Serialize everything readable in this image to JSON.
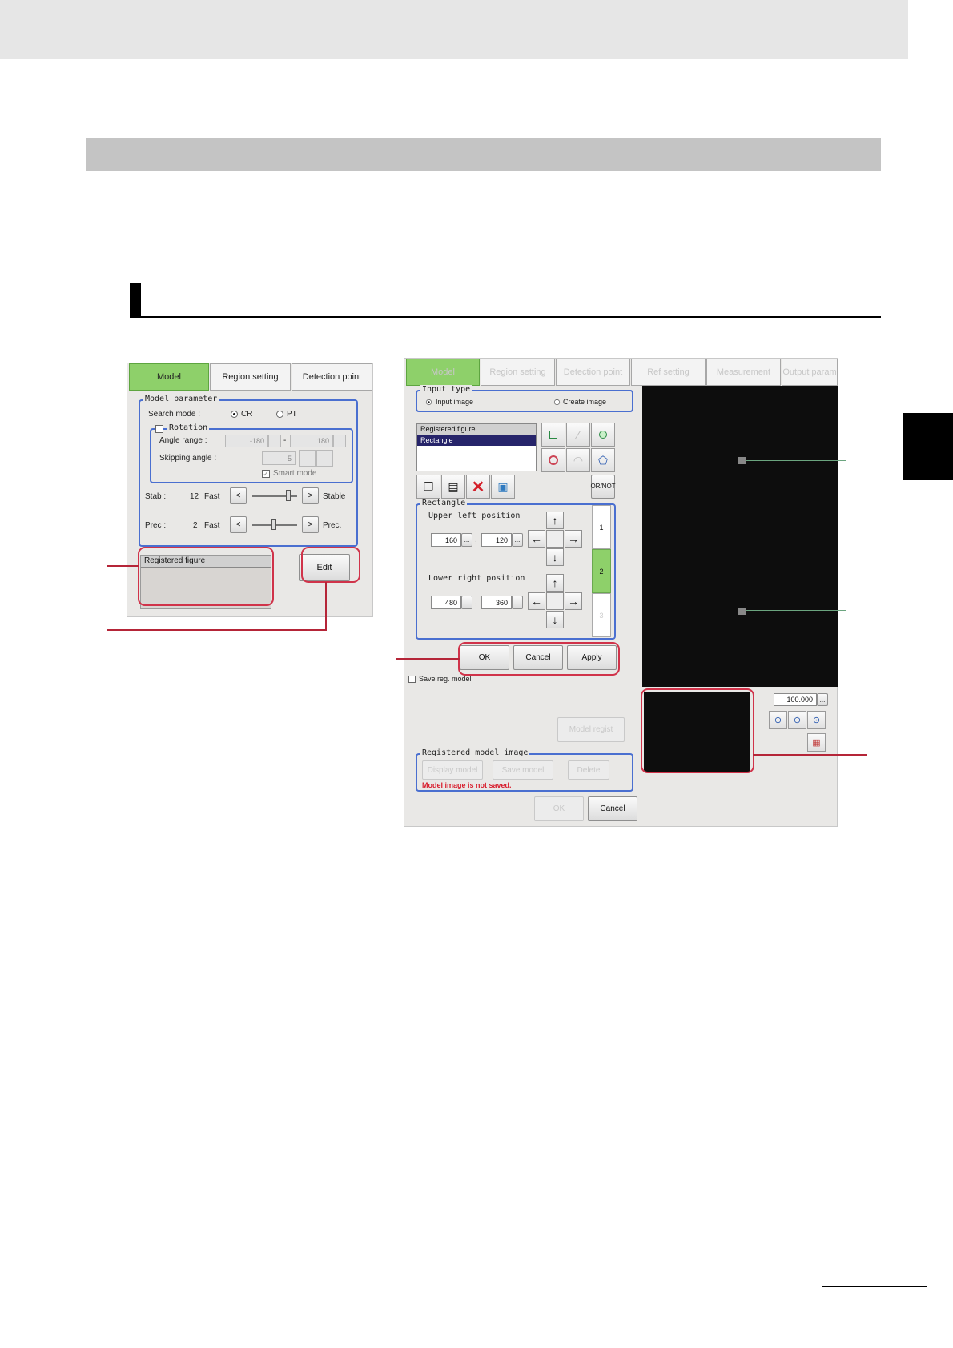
{
  "left_panel": {
    "tabs": [
      "Model",
      "Region setting",
      "Detection point"
    ],
    "model_parameter": {
      "title": "Model parameter",
      "search_mode_label": "Search mode :",
      "search_mode_options": [
        "CR",
        "PT"
      ],
      "search_mode_selected": "CR",
      "rotation": {
        "title": "Rotation",
        "checked": false,
        "angle_range_label": "Angle range :",
        "angle_min": "-180",
        "angle_sep": "-",
        "angle_max": "180",
        "skipping_angle_label": "Skipping angle :",
        "skipping_angle": "5",
        "smart_mode_label": "Smart mode",
        "smart_mode_checked": true
      },
      "stab": {
        "label": "Stab :",
        "value": "12",
        "left": "Fast",
        "right": "Stable",
        "dec": "<",
        "inc": ">"
      },
      "prec": {
        "label": "Prec :",
        "value": "2",
        "left": "Fast",
        "right": "Prec.",
        "dec": "<",
        "inc": ">"
      }
    },
    "registered_figure_label": "Registered figure",
    "edit_button": "Edit"
  },
  "right_panel": {
    "tabs": [
      "Model",
      "Region setting",
      "Detection point",
      "Ref setting",
      "Measurement",
      "Output param"
    ],
    "input_type": {
      "title": "Input type",
      "options": [
        "Input image",
        "Create image"
      ],
      "selected": "Input image"
    },
    "registered_figure": {
      "header": "Registered figure",
      "items": [
        "Rectangle"
      ],
      "selected": "Rectangle"
    },
    "or_not_button": "OR/NOT",
    "rectangle": {
      "title": "Rectangle",
      "upper_left_label": "Upper left position",
      "upper_left_x": "160",
      "upper_left_y": "120",
      "lower_right_label": "Lower right position",
      "lower_right_x": "480",
      "lower_right_y": "360",
      "comma": ",",
      "dots": "...",
      "arrows": {
        "up": "↑",
        "down": "↓",
        "left": "←",
        "right": "→"
      },
      "steps": [
        "1",
        "2",
        "3"
      ],
      "active_step": "2"
    },
    "dialog_buttons": [
      "OK",
      "Cancel",
      "Apply"
    ],
    "save_reg_model_label": "Save reg. model",
    "model_registration_button": "Model regist",
    "registered_model_image": {
      "title": "Registered model image",
      "buttons": [
        "Display model",
        "Save model",
        "Delete"
      ],
      "warning": "Model image is not saved."
    },
    "bottom_buttons": [
      "OK",
      "Cancel"
    ],
    "zoom_value": "100.000",
    "zoom_dots": "..."
  },
  "colors": {
    "tab_active": "#8ed06a",
    "group_border": "#4a6fd0",
    "callout_red": "#d0334a",
    "warning_red": "#d8202f"
  }
}
